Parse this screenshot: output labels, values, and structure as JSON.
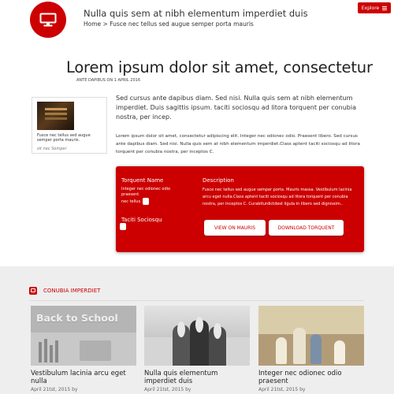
{
  "header": {
    "site_title": "Nulla quis sem at nibh elementum imperdiet duis",
    "breadcrumb": "Home > Fusce nec tellus sed augue semper porta mauris",
    "explore_label": "Explore"
  },
  "article": {
    "headline": "Lorem ipsum dolor sit amet, consectetur",
    "byline": "ANTE DAPIBUS ON 1 APRIL 2016",
    "figure_caption": "Fusce nec tellus sed augue semper porta mauris.",
    "figure_credit": "sit nec Semper",
    "lead": "Sed cursus ante dapibus diam. Sed nisi. Nulla quis sem at nibh elementum imperdiet. Duis sagittis ipsum. taciti sociosqu ad litora torquent per conubia nostra, per incep.",
    "body": "Lorem ipsum dolor sit amet, consectetur adipiscing elit. Integer nec odionec odio. Praesent libero. Sed cursus ante dapibus diam. Sed nisi. Nulla quis sem at nibh elementum imperdiet.Class aptent taciti sociosqu ad litora torquent per conubia nostra, per inceptos C."
  },
  "panel": {
    "label1": "Torquent Name",
    "text1": "Integer nec odionec odio praesent",
    "text2": "nec tellus",
    "label2": "Taciti Sociosqu",
    "desc_heading": "Description",
    "desc_text": "Fusce nec tellus sed augue semper porta. Mauris massa. Vestibulum lacinia arcu eget nulla.Class aptent taciti sociosqu ad litora torquent per conubia nostra, per inceptos C. Curabiturdictdest ligula in libero sed dignissim..",
    "button1": "VIEW ON MAURIS",
    "button2": "DOWNLOAD TORQUENT"
  },
  "section": {
    "title": "CONUBIA IMPERDIET",
    "cards": [
      {
        "title": "Vestibulum lacinia arcu eget nulla",
        "date": "April 21tst, 2015 by",
        "image_text": "Back to School"
      },
      {
        "title": "Nulla quis elementum imperdiet duis",
        "date": "April 21tst, 2015 by"
      },
      {
        "title": "Integer nec odionec odio praesent",
        "date": "April 21tst, 2015 by"
      }
    ]
  },
  "colors": {
    "accent": "#cc0000",
    "bottom_bg": "#eeeeee"
  },
  "icons": {
    "logo": "monitor-icon",
    "explore": "hamburger-menu-icon",
    "section": "image-icon"
  }
}
